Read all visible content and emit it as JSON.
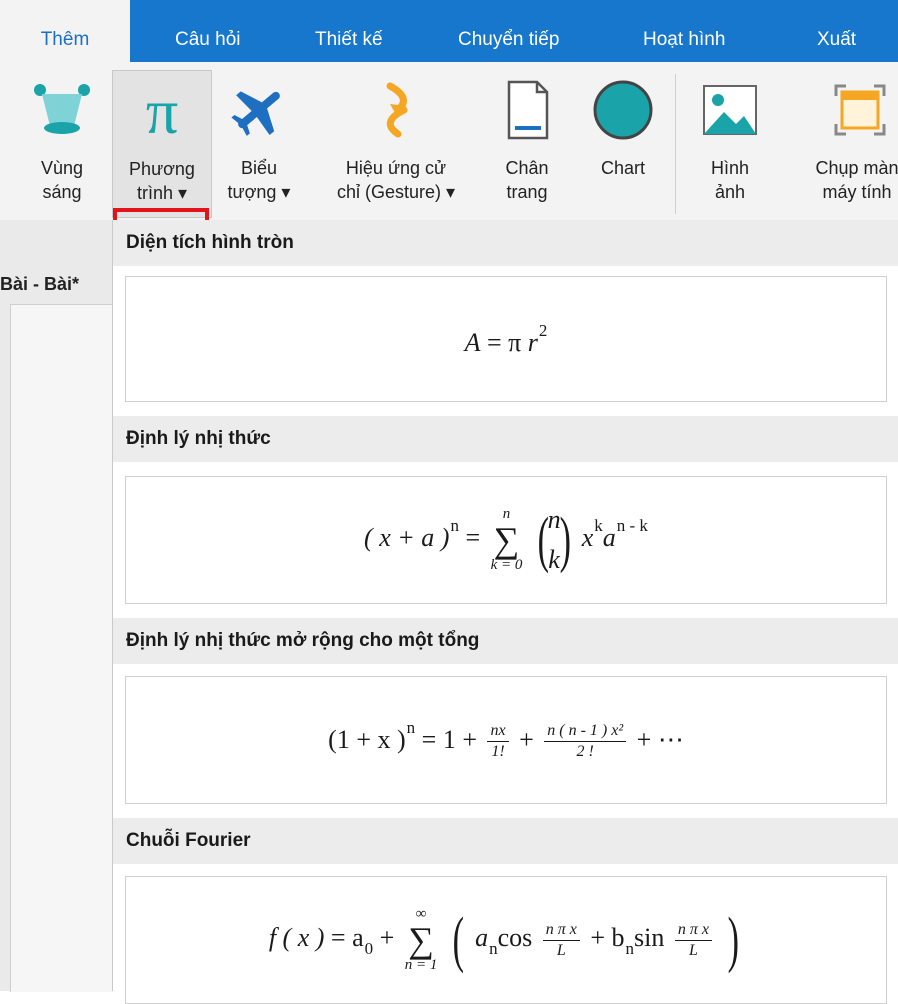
{
  "tabs": [
    "Thêm",
    "Câu hỏi",
    "Thiết kế",
    "Chuyển tiếp",
    "Hoạt hình",
    "Xuất"
  ],
  "ribbon": {
    "buttons": [
      {
        "label": "Vùng\nsáng",
        "icon": "spotlight-icon"
      },
      {
        "label": "Phương\ntrình ▾",
        "icon": "pi-icon"
      },
      {
        "label": "Biểu\ntượng ▾",
        "icon": "airplane-icon"
      },
      {
        "label": "Hiệu ứng cử\nchỉ (Gesture) ▾",
        "icon": "gesture-icon"
      },
      {
        "label": "Chân\ntrang",
        "icon": "footer-page-icon"
      },
      {
        "label": "Chart",
        "icon": "circle-shape-icon"
      },
      {
        "label": "Hình\nảnh",
        "icon": "image-icon"
      },
      {
        "label": "Chụp màn\nmáy tính",
        "icon": "screenshot-icon"
      }
    ]
  },
  "document": {
    "tab_label": "Bài - Bài*"
  },
  "gallery": {
    "sections": [
      {
        "title": "Diện tích hình tròn",
        "formula": {
          "lhs": "A",
          "eq": "=",
          "pi": "π",
          "r": "r",
          "exp": "2"
        }
      },
      {
        "title": "Định lý nhị thức",
        "formula": {
          "lhs": "( x + a )",
          "exp": "n",
          "eq": "=",
          "sum_top": "n",
          "sum_sym": "∑",
          "sum_bottom": "k = 0",
          "binom_top": "n",
          "binom_bottom": "k",
          "x": "x",
          "x_exp": "k",
          "a": "a",
          "a_exp": "n - k"
        }
      },
      {
        "title": "Định lý nhị thức mở rộng cho một tổng",
        "formula": {
          "lhs": "(1 + x )",
          "exp": "n",
          "eq": "= 1 +",
          "f1_num": "nx",
          "f1_den": "1!",
          "plus": "+",
          "f2_num": "n ( n - 1 ) x²",
          "f2_den": "2 !",
          "tail": "+ ⋯"
        }
      },
      {
        "title": "Chuỗi Fourier",
        "formula": {
          "lhs": "f ( x )",
          "eq": "= a",
          "a_sub": "0",
          "plus": "+",
          "sum_top": "∞",
          "sum_sym": "∑",
          "sum_bottom": "n = 1",
          "an": "a",
          "an_sub": "n",
          "cos": "cos",
          "frac_num": "n π x",
          "frac_den": "L",
          "plus2": "+ b",
          "bn_sub": "n",
          "sin": "sin"
        }
      }
    ]
  },
  "colors": {
    "tabbar": "#1777cc",
    "highlight_border": "#e1141b",
    "teal": "#1aa3a8",
    "orange": "#f5a623"
  }
}
